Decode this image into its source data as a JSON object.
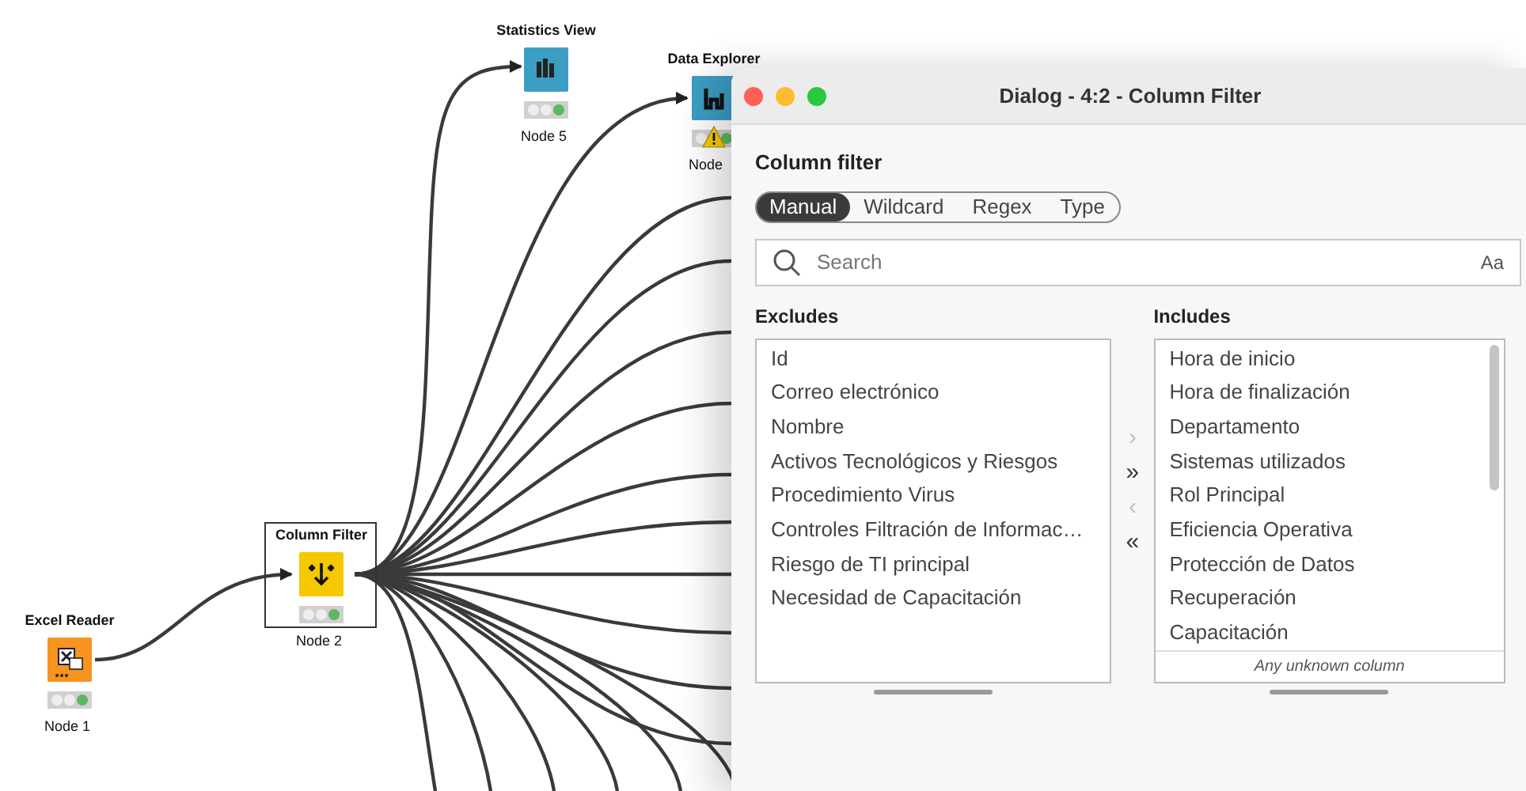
{
  "workflow": {
    "nodes": [
      {
        "kind": "statistics",
        "title": "Statistics View",
        "label": "Node 5",
        "color": "#3d9ec4",
        "warning": false
      },
      {
        "kind": "explorer",
        "title": "Data Explorer",
        "label": "Node",
        "color": "#3d9ec4",
        "warning": true
      },
      {
        "kind": "filter",
        "title": "Column Filter",
        "label": "Node 2",
        "color": "#f5c800",
        "warning": false,
        "selected": true
      },
      {
        "kind": "reader",
        "title": "Excel Reader",
        "label": "Node 1",
        "color": "#f7931e",
        "warning": false,
        "selected": false
      }
    ]
  },
  "dialog": {
    "title": "Dialog - 4:2 - Column Filter",
    "section": "Column filter",
    "tabs": [
      {
        "label": "Manual",
        "selected": true
      },
      {
        "label": "Wildcard",
        "selected": false
      },
      {
        "label": "Regex",
        "selected": false
      },
      {
        "label": "Type",
        "selected": false
      }
    ],
    "search": {
      "placeholder": "Search",
      "case_toggle": "Aa"
    },
    "excludes": {
      "title": "Excludes",
      "items": [
        "Id",
        "Correo electrónico",
        "Nombre",
        "Activos Tecnológicos y Riesgos",
        "Procedimiento Virus",
        "Controles Filtración de Informac…",
        "Riesgo de TI principal",
        "Necesidad de Capacitación"
      ]
    },
    "transfer_buttons": [
      {
        "label": "›",
        "disabled": true
      },
      {
        "label": "»",
        "disabled": false
      },
      {
        "label": "‹",
        "disabled": true
      },
      {
        "label": "«",
        "disabled": false
      }
    ],
    "includes": {
      "title": "Includes",
      "items": [
        "Hora de inicio",
        "Hora de finalización",
        "Departamento",
        "Sistemas utilizados",
        "Rol Principal",
        "Eficiencia Operativa",
        "Protección de Datos",
        "Recuperación",
        "Capacitación"
      ],
      "footer": "Any unknown column"
    }
  }
}
